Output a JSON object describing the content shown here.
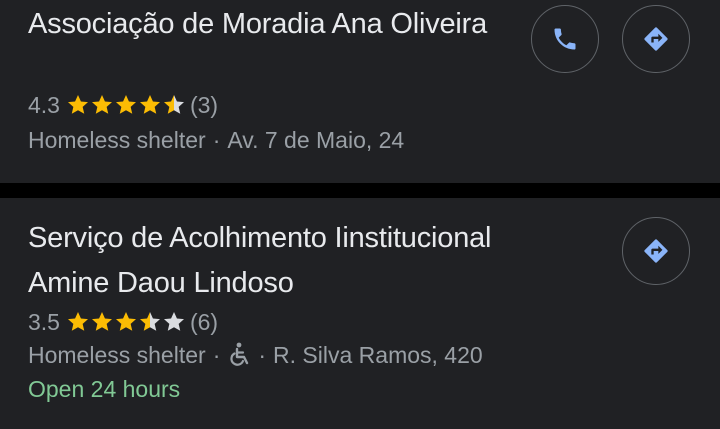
{
  "colors": {
    "background": "#000000",
    "card": "#202124",
    "title_text": "#e8eaed",
    "secondary_text": "#9aa0a6",
    "star": "#fbbc04",
    "star_empty": "#dadce0",
    "open_status": "#81c995",
    "button_icon": "#8ab4f8",
    "button_border": "#5f6368"
  },
  "results": [
    {
      "title": "Associação de Moradia Ana Oliveira",
      "rating": "4.3",
      "rating_value": 4.3,
      "review_count": "(3)",
      "category": "Homeless shelter",
      "separator": "·",
      "address": "Av. 7 de Maio, 24",
      "actions": [
        "phone-icon",
        "directions-icon"
      ]
    },
    {
      "title": "Serviço de Acolhimento Iinstitucional Amine Daou Lindoso",
      "rating": "3.5",
      "rating_value": 3.5,
      "review_count": "(6)",
      "category": "Homeless shelter",
      "separator": "·",
      "accessibility_icon": "wheelchair-accessible-icon",
      "address": "R. Silva Ramos, 420",
      "hours": "Open 24 hours",
      "actions": [
        "directions-icon"
      ]
    }
  ]
}
